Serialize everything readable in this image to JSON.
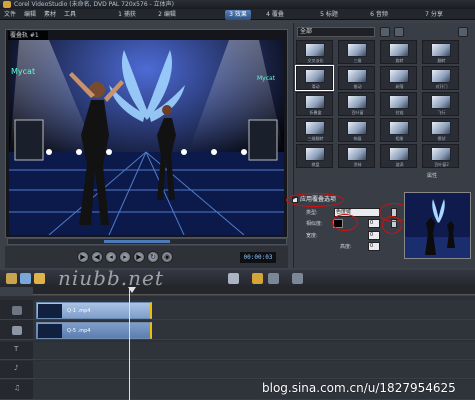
{
  "titlebar": {
    "title": "Corel VideoStudio (未命名, DVD PAL 720x576 - 立体声)"
  },
  "menu": [
    "文件",
    "编辑",
    "素材",
    "工具"
  ],
  "steps": [
    "1 捕获",
    "2 编辑",
    "3 效果",
    "4 覆叠",
    "5 标题",
    "6 音频",
    "7 分享"
  ],
  "active_step": "3 效果",
  "preview": {
    "track_label": "覆叠轨 #1",
    "timecode": "00:00:03",
    "stage_text_left": "Mycat",
    "stage_text_right": "Mycat"
  },
  "library": {
    "category": "全部",
    "tiles": [
      "交叉淡化",
      "三维",
      "旋转",
      "翻转",
      "滑动",
      "推动",
      "剥落",
      "对开门",
      "折叠盒",
      "百叶窗",
      "拉链",
      "飞行",
      "三维翻转",
      "伸展",
      "相册",
      "擦拭",
      "棋盘",
      "涂抹",
      "漩涡",
      "百叶窗2",
      "卷动",
      "溶解",
      "星形",
      "菱形"
    ]
  },
  "options": {
    "section_label": "属性",
    "apply_mask_label": "应用覆叠选项",
    "type_label": "类型:",
    "type_value": "色度键",
    "similarity_label": "相似度:",
    "similarity_value": "0",
    "width_label": "宽度:",
    "width_value": "0",
    "height_label": "高度:",
    "height_value": "0"
  },
  "timeline": {
    "tracks": [
      {
        "name": "video",
        "clips": [
          {
            "label": "Q-1 .mp4",
            "start": 0,
            "end": 115
          }
        ]
      },
      {
        "name": "overlay",
        "clips": [
          {
            "label": "Q-5 .mp4",
            "start": 0,
            "end": 115
          }
        ]
      },
      {
        "name": "title",
        "clips": []
      },
      {
        "name": "voice",
        "clips": []
      },
      {
        "name": "music",
        "clips": []
      }
    ]
  },
  "watermarks": {
    "middle": "niubb.net",
    "corner": "blog.sina.com.cn/u/1827954625"
  }
}
